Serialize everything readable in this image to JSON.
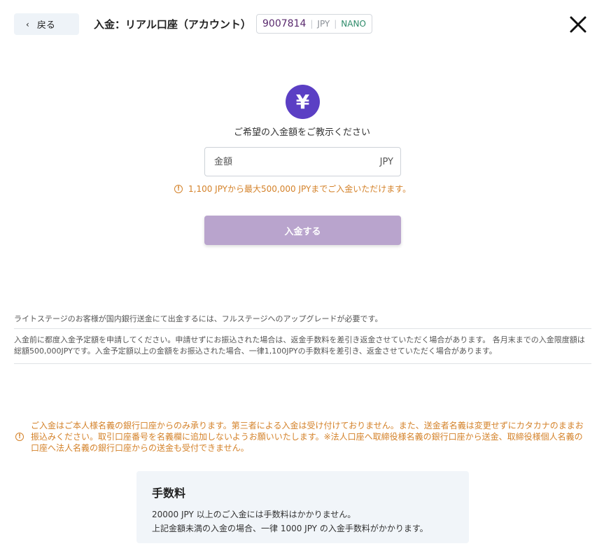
{
  "header": {
    "back_label": "戻る",
    "title": "入金：リアル口座（アカウント）",
    "account_number": "9007814",
    "currency": "JPY",
    "account_type": "NANO"
  },
  "main": {
    "prompt": "ご希望の入金額をご教示ください",
    "amount_placeholder": "金額",
    "amount_unit": "JPY",
    "range_note": "1,100 JPYから最大500,000 JPYまでご入金いただけます。",
    "deposit_button": "入金する"
  },
  "notices": {
    "upgrade": "ライトステージのお客様が国内銀行送金にて出金するには、フルステージへのアップグレードが必要です。",
    "limit": "入金前に都度入金予定額を申請してください。申請せずにお振込された場合は、返金手数料を差引き返金させていただく場合があります。 各月末までの入金限度額は総額500,000JPYです。入金予定額以上の金額をお振込された場合、一律1,100JPYの手数料を差引き、返金させていただく場合があります。",
    "bank_warning": "ご入金はご本人様名義の銀行口座からのみ承ります。第三者による入金は受け付けておりません。また、送金者名義は変更せずにカタカナのままお振込みください。取引口座番号を名義欄に追加しないようお願いいたします。※法人口座へ取締役様名義の銀行口座から送金、取締役様個人名義の口座へ法人名義の銀行口座からの送金も受付できません。"
  },
  "fee": {
    "title": "手数料",
    "line1": "20000 JPY 以上のご入金には手数料はかかりません。",
    "line2": "上記金額未満の入金の場合、一律 1000 JPY の入金手数料がかかります。"
  },
  "colors": {
    "accent": "#5b3fc4",
    "button_disabled": "#b9a4cd",
    "warning": "#d4822a",
    "account_type": "#2e8b6a"
  },
  "icons": {
    "back": "chevron-left-icon",
    "close": "close-icon",
    "currency": "yen-icon",
    "warning": "warning-circle-icon"
  }
}
